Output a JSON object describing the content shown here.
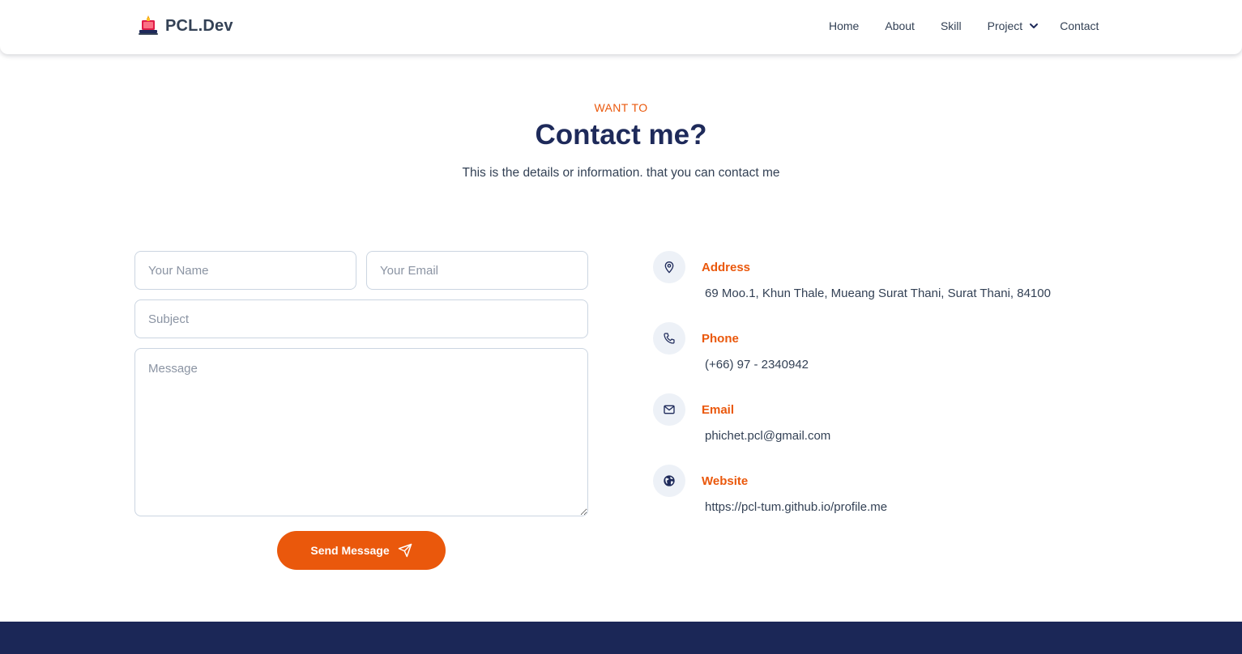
{
  "brand": {
    "name": "PCL.Dev"
  },
  "nav": {
    "items": [
      "Home",
      "About",
      "Skill",
      "Project",
      "Contact"
    ]
  },
  "section": {
    "eyebrow": "WANT TO",
    "title": "Contact me?",
    "subtitle": "This is the details or information. that you can contact me"
  },
  "form": {
    "name_placeholder": "Your Name",
    "email_placeholder": "Your Email",
    "subject_placeholder": "Subject",
    "message_placeholder": "Message",
    "send_label": "Send Message"
  },
  "contact_info": [
    {
      "icon": "location-pin-icon",
      "label": "Address",
      "value": "69 Moo.1, Khun Thale, Mueang Surat Thani, Surat Thani, 84100"
    },
    {
      "icon": "phone-icon",
      "label": "Phone",
      "value": "(+66) 97 - 2340942"
    },
    {
      "icon": "mail-icon",
      "label": "Email",
      "value": "phichet.pcl@gmail.com"
    },
    {
      "icon": "globe-icon",
      "label": "Website",
      "value": "https://pcl-tum.github.io/profile.me"
    }
  ],
  "colors": {
    "accent": "#ea580c",
    "heading": "#1e2a5a",
    "text": "#334155",
    "footer": "#1b2757",
    "icon_bg": "#edf1f7"
  }
}
